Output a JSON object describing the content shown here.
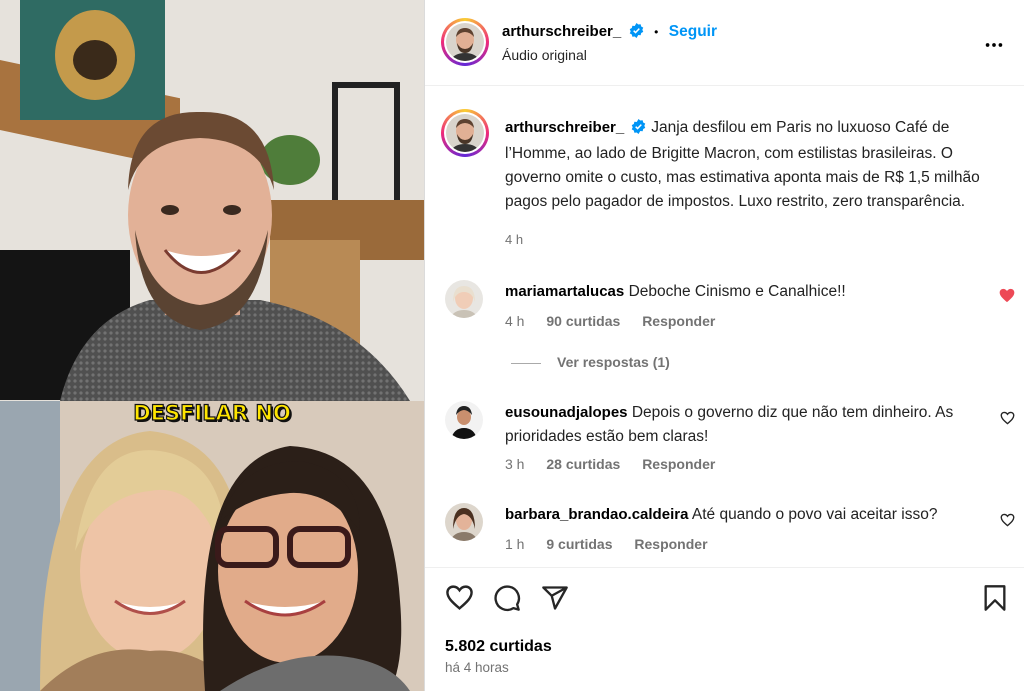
{
  "post": {
    "username": "arthurschreiber_",
    "follow_label": "Seguir",
    "separator": "•",
    "audio_label": "Áudio original",
    "caption_text": "Janja desfilou em Paris no luxuoso Café de l’Homme, ao lado de Brigitte Macron, com estilistas brasileiras. O governo omite o custo, mas estimativa aponta mais de R$ 1,5 milhão pagos pelo pagador de impostos. Luxo restrito, zero transparência.",
    "caption_time": "4 h",
    "likes_label": "5.802 curtidas",
    "posted_ago": "há 4 horas"
  },
  "media": {
    "overlay_text": "DESFILAR NO"
  },
  "comments": [
    {
      "username": "mariamartalucas",
      "text": "Deboche Cinismo e Canalhice!!",
      "time": "4 h",
      "likes": "90 curtidas",
      "reply_label": "Responder",
      "liked": true
    },
    {
      "username": "eusounadjalopes",
      "text": "Depois o governo diz que não tem dinheiro. As prioridades estão bem claras!",
      "time": "3 h",
      "likes": "28 curtidas",
      "reply_label": "Responder",
      "liked": false
    },
    {
      "username": "barbara_brandao.caldeira",
      "text": "Até quando o povo vai aceitar isso?",
      "time": "1 h",
      "likes": "9 curtidas",
      "reply_label": "Responder",
      "liked": false
    }
  ],
  "view_replies_label": "Ver respostas (1)",
  "icons": {
    "verified": "verified-badge-icon",
    "more": "more-options-icon",
    "like": "heart-icon",
    "comment": "comment-bubble-icon",
    "share": "paper-plane-icon",
    "save": "bookmark-icon"
  },
  "colors": {
    "accent": "#0095f6",
    "liked_heart": "#ed4956",
    "muted": "#737373"
  }
}
